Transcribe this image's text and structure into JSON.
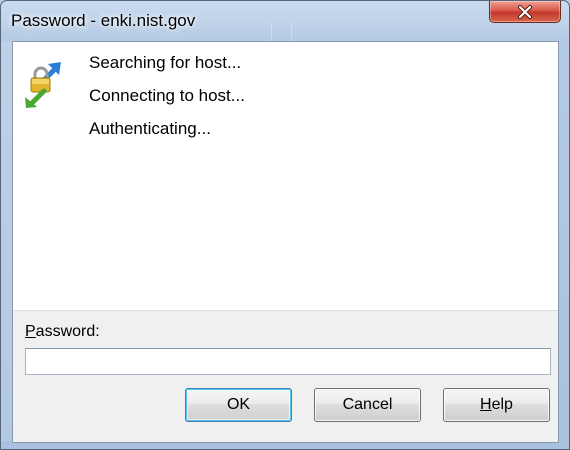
{
  "window": {
    "title": "Password - enki.nist.gov"
  },
  "status_lines": [
    "Searching for host...",
    "Connecting to host...",
    "Authenticating..."
  ],
  "password": {
    "label_first": "P",
    "label_rest": "assword:",
    "value": ""
  },
  "buttons": {
    "ok": "OK",
    "cancel": "Cancel",
    "help_first": "H",
    "help_rest": "elp"
  },
  "icons": {
    "app": "lock-arrows-icon",
    "close": "close-icon"
  },
  "colors": {
    "close_button": "#c9473a",
    "arrow_blue": "#2a7fd6",
    "arrow_green": "#4aa934",
    "lock_gold": "#e2b52c"
  }
}
